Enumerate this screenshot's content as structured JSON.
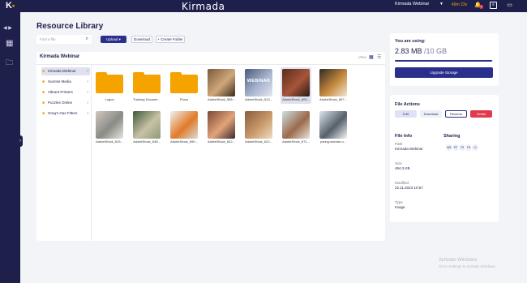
{
  "topbar": {
    "logo": "K",
    "brand": "Kirmada",
    "workspace": "Kirmada Webinar",
    "timer": "49m 23s",
    "notifications_count": "1"
  },
  "page": {
    "title": "Resource Library"
  },
  "toolbar": {
    "search_placeholder": "Find a file",
    "upload_label": "Upload",
    "download_label": "Download",
    "create_folder_label": "+ Create Folder"
  },
  "library": {
    "title": "Kirmada Webinar",
    "view_label": "View",
    "tree": [
      {
        "label": "Kirmada Webinar",
        "selected": true
      },
      {
        "label": "Sunrise Media"
      },
      {
        "label": "Vibrant Printers"
      },
      {
        "label": "Puzzles Online"
      },
      {
        "label": "Greg's Gas Fitters"
      }
    ],
    "items": [
      {
        "type": "folder",
        "name": "Logos"
      },
      {
        "type": "folder",
        "name": "Training Docume..."
      },
      {
        "type": "folder",
        "name": "Procs"
      },
      {
        "type": "image",
        "name": "AdobeStock_558...",
        "colors": [
          "#7a5a3c",
          "#cfa77a",
          "#3a2a1e"
        ]
      },
      {
        "type": "image",
        "name": "AdobeStock_513...",
        "colors": [
          "#4b5a78",
          "#a7b5cf",
          "#e6e8ef"
        ],
        "overlay": "WEBINAR"
      },
      {
        "type": "image",
        "name": "AdobeStock_609...",
        "colors": [
          "#5c2c1a",
          "#a6553a",
          "#2a1a12"
        ],
        "selected": true
      },
      {
        "type": "image",
        "name": "AdobeStock_657...",
        "colors": [
          "#2e2a24",
          "#c6893e",
          "#f2e7d3"
        ]
      },
      {
        "type": "image",
        "name": "AdobeStock_615...",
        "colors": [
          "#cfc9bf",
          "#8a8a86",
          "#e9e6e0"
        ]
      },
      {
        "type": "image",
        "name": "AdobeStock_648...",
        "colors": [
          "#3f5a3b",
          "#c8c1a5",
          "#8f9a7a"
        ]
      },
      {
        "type": "image",
        "name": "AdobeStock_650...",
        "colors": [
          "#f2f2f0",
          "#e07a2a",
          "#dcdcd8"
        ]
      },
      {
        "type": "image",
        "name": "AdobeStock_642...",
        "colors": [
          "#7a4a36",
          "#e2a37a",
          "#3b2a2a"
        ]
      },
      {
        "type": "image",
        "name": "AdobeStock_622...",
        "colors": [
          "#8a5c3e",
          "#c99a6a",
          "#f0dcc0"
        ]
      },
      {
        "type": "image",
        "name": "AdobeStock_671...",
        "colors": [
          "#cfe0e6",
          "#9a6a4a",
          "#e8e4da"
        ]
      },
      {
        "type": "image",
        "name": "young-woman-u...",
        "colors": [
          "#dfe6ea",
          "#55606a",
          "#f5f5f5"
        ]
      }
    ]
  },
  "storage": {
    "heading": "You are using:",
    "used": "2.83 MB",
    "total": "/10 GB",
    "fraction_used": 0.99,
    "upgrade_label": "Upgrade Storage"
  },
  "file_actions": {
    "heading": "File Actions",
    "edit": "Edit",
    "download": "Download",
    "rename": "Rename",
    "delete": "Delete"
  },
  "file_info": {
    "heading": "File Info",
    "path_label": "Path",
    "path_value": "Kirmada Webinar",
    "size_label": "Size",
    "size_value": "494.3 KB",
    "modified_label": "Modified",
    "modified_value": "22.11.2023 10:57",
    "type_label": "Type",
    "type_value": "Image"
  },
  "sharing": {
    "heading": "Sharing",
    "avatars": [
      "WE",
      "FF",
      "TS",
      "TH",
      "+1"
    ]
  },
  "watermark": {
    "line1": "Activate Windows",
    "line2": "Go to Settings to activate Windows."
  },
  "colors": {
    "navy": "#1e1f4b",
    "accent": "#2a2e8c",
    "folder": "#f4a300",
    "danger": "#e03a4e"
  }
}
